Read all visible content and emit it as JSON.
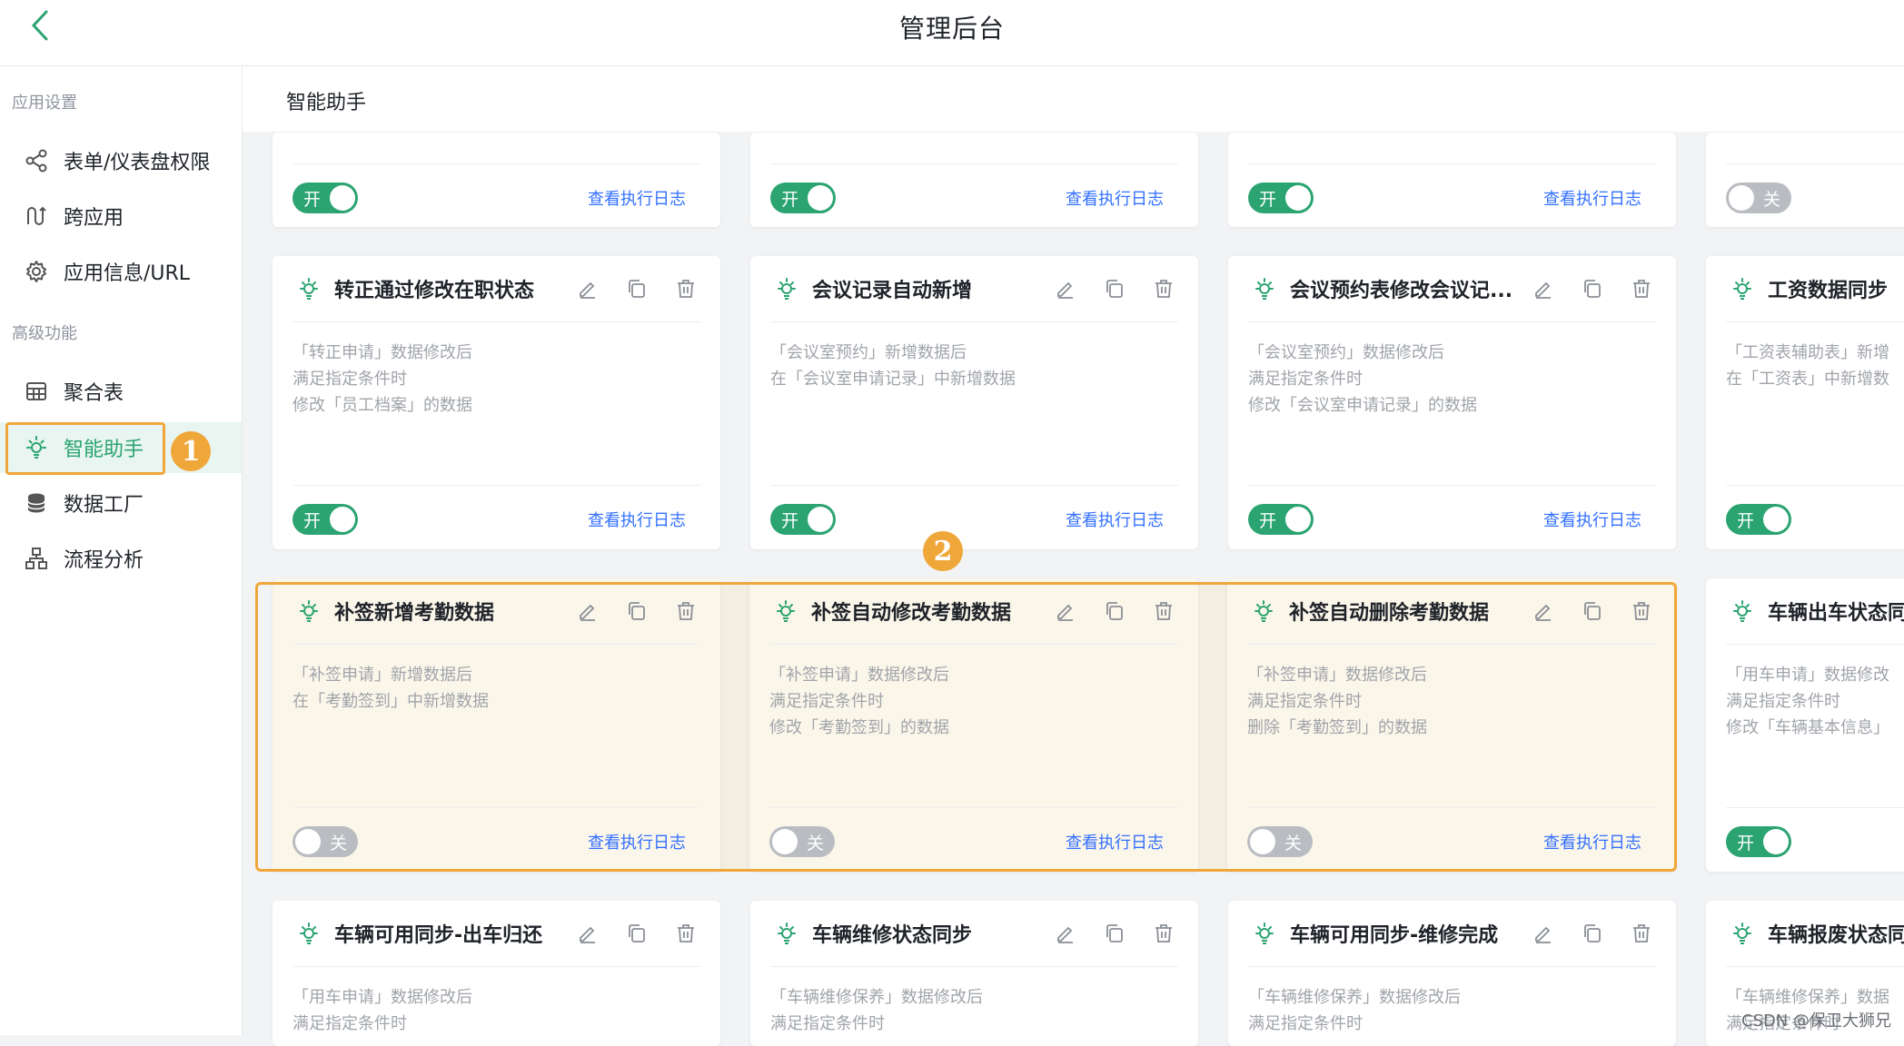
{
  "header": {
    "title": "管理后台"
  },
  "sidebar": {
    "group1": "应用设置",
    "group2": "高级功能",
    "items": [
      {
        "label": "表单/仪表盘权限",
        "icon": "share-icon"
      },
      {
        "label": "跨应用",
        "icon": "cross-app-icon"
      },
      {
        "label": "应用信息/URL",
        "icon": "gear-icon"
      },
      {
        "label": "聚合表",
        "icon": "table-icon"
      },
      {
        "label": "智能助手",
        "icon": "bulb-icon"
      },
      {
        "label": "数据工厂",
        "icon": "database-icon"
      },
      {
        "label": "流程分析",
        "icon": "flow-icon"
      }
    ]
  },
  "annotations": {
    "badge1": "1",
    "badge2": "2"
  },
  "main": {
    "title": "智能助手"
  },
  "common": {
    "log_label": "查看执行日志",
    "on_label": "开",
    "off_label": "关"
  },
  "cards": {
    "r0": [
      {
        "toggle": "on"
      },
      {
        "toggle": "on"
      },
      {
        "toggle": "on"
      },
      {
        "toggle": "off"
      }
    ],
    "r1": [
      {
        "title": "转正通过修改在职状态",
        "desc": [
          "「转正申请」数据修改后",
          "满足指定条件时",
          "修改「员工档案」的数据"
        ],
        "toggle": "on"
      },
      {
        "title": "会议记录自动新增",
        "desc": [
          "「会议室预约」新增数据后",
          "在「会议室申请记录」中新增数据"
        ],
        "toggle": "on"
      },
      {
        "title": "会议预约表修改会议记...",
        "desc": [
          "「会议室预约」数据修改后",
          "满足指定条件时",
          "修改「会议室申请记录」的数据"
        ],
        "toggle": "on"
      },
      {
        "title": "工资数据同步",
        "desc": [
          "「工资表辅助表」新增",
          "在「工资表」中新增数"
        ],
        "toggle": "on"
      }
    ],
    "r2": [
      {
        "title": "补签新增考勤数据",
        "desc": [
          "「补签申请」新增数据后",
          "在「考勤签到」中新增数据"
        ],
        "toggle": "off"
      },
      {
        "title": "补签自动修改考勤数据",
        "desc": [
          "「补签申请」数据修改后",
          "满足指定条件时",
          "修改「考勤签到」的数据"
        ],
        "toggle": "off"
      },
      {
        "title": "补签自动删除考勤数据",
        "desc": [
          "「补签申请」数据修改后",
          "满足指定条件时",
          "删除「考勤签到」的数据"
        ],
        "toggle": "off"
      },
      {
        "title": "车辆出车状态同",
        "desc": [
          "「用车申请」数据修改",
          "满足指定条件时",
          "修改「车辆基本信息」"
        ],
        "toggle": "on"
      }
    ],
    "r3": [
      {
        "title": "车辆可用同步-出车归还",
        "desc": [
          "「用车申请」数据修改后",
          "满足指定条件时"
        ]
      },
      {
        "title": "车辆维修状态同步",
        "desc": [
          "「车辆维修保养」数据修改后",
          "满足指定条件时"
        ]
      },
      {
        "title": "车辆可用同步-维修完成",
        "desc": [
          "「车辆维修保养」数据修改后",
          "满足指定条件时"
        ]
      },
      {
        "title": "车辆报废状态同",
        "desc": [
          "「车辆维修保养」数据",
          "满足指定条件时"
        ]
      }
    ]
  },
  "watermark": "CSDN @保卫大狮兄"
}
